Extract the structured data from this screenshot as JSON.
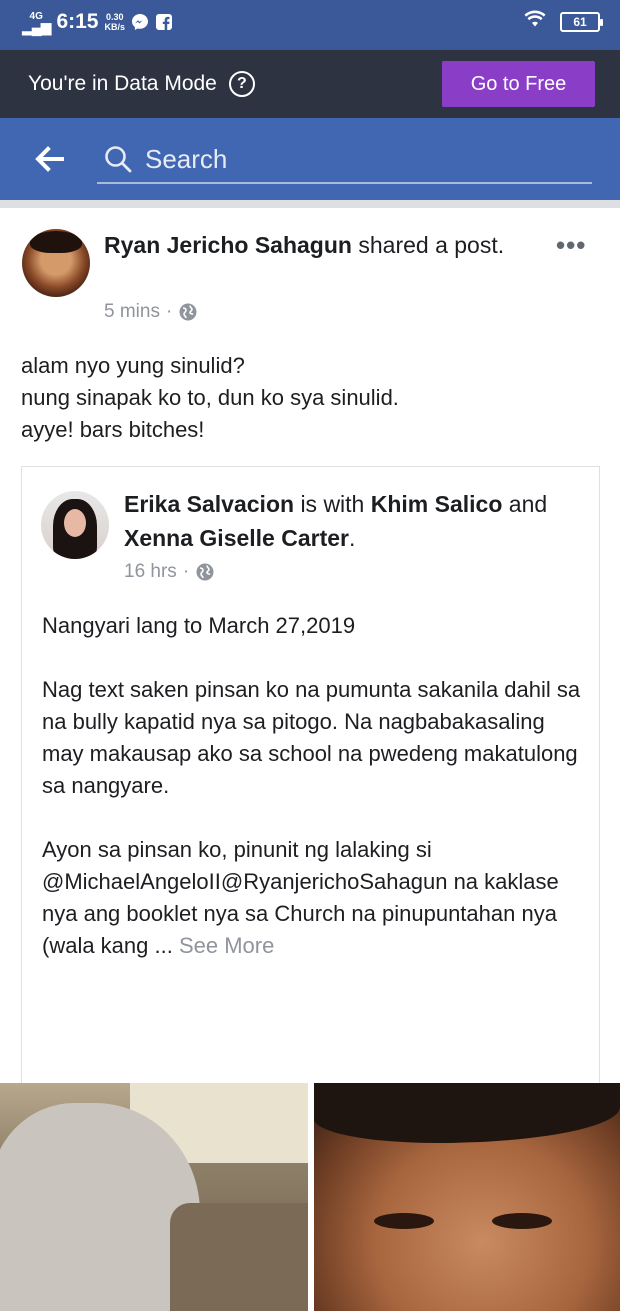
{
  "status_bar": {
    "network": "4G",
    "time": "6:15",
    "speed_value": "0.30",
    "speed_unit": "KB/s",
    "battery": "61"
  },
  "data_mode": {
    "text": "You're in Data Mode",
    "help_symbol": "?",
    "button_label": "Go to Free"
  },
  "nav": {
    "search_placeholder": "Search"
  },
  "post": {
    "author": "Ryan Jericho Sahagun",
    "action": "shared a post.",
    "time": "5 mins",
    "body_lines": [
      "alam nyo yung sinulid?",
      "nung sinapak ko to, dun ko sya sinulid.",
      "ayye! bars bitches!"
    ]
  },
  "shared_post": {
    "author": "Erika Salvacion",
    "is_with": "is with",
    "tag1": "Khim Salico",
    "and": "and",
    "tag2": "Xenna Giselle Carter",
    "time": "16 hrs",
    "paragraphs": [
      "Nangyari lang to March 27,2019",
      "Nag text saken pinsan ko na pumunta sakanila dahil sa na bully kapatid nya sa pitogo. Na nagbabakasaling may makausap ako sa school na pwedeng makatulong sa nangyare.",
      "Ayon sa pinsan ko, pinunit ng lalaking si @MichaelAngeloII@RyanjerichoSahagun na kaklase nya ang booklet nya sa Church na pinupuntahan nya"
    ],
    "truncated_line": "(wala kang ...",
    "see_more": "See More"
  },
  "colors": {
    "status_bar": "#3b5998",
    "data_bar": "#2d3340",
    "free_button": "#8a3ec8",
    "nav_bar": "#4267b2",
    "meta_text": "#90949c"
  }
}
